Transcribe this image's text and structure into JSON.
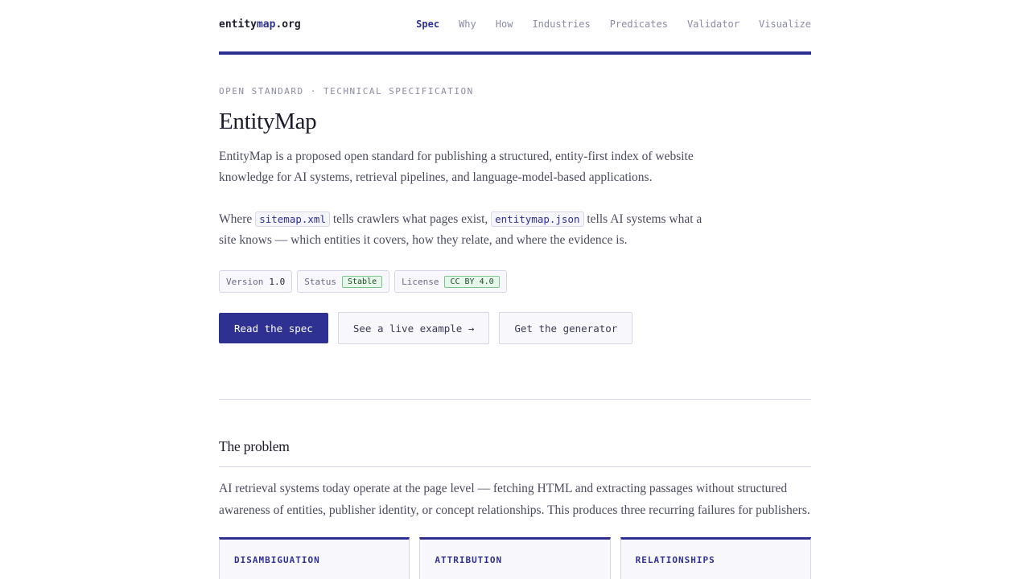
{
  "header": {
    "logo": {
      "part1": "entity",
      "part2": "map",
      "part3": ".org"
    },
    "nav": [
      {
        "label": "Spec",
        "active": true
      },
      {
        "label": "Why",
        "active": false
      },
      {
        "label": "How",
        "active": false
      },
      {
        "label": "Industries",
        "active": false
      },
      {
        "label": "Predicates",
        "active": false
      },
      {
        "label": "Validator",
        "active": false
      },
      {
        "label": "Visualize",
        "active": false
      }
    ]
  },
  "hero": {
    "eyebrow": "OPEN STANDARD · TECHNICAL SPECIFICATION",
    "title": "EntityMap",
    "lead": "EntityMap is a proposed open standard for publishing a structured, entity-first index of website knowledge for AI systems, retrieval pipelines, and language-model-based applications.",
    "compare": {
      "where": "Where",
      "code1": "sitemap.xml",
      "mid": "tells crawlers what pages exist,",
      "code2": "entitymap.json",
      "end": "tells AI systems what a site knows — which entities it covers, how they relate, and where the evidence is."
    },
    "badges": {
      "version_label": "Version",
      "version_value": "1.0",
      "status_label": "Status",
      "status_value": "Stable",
      "license_label": "License",
      "license_value": "CC BY 4.0"
    },
    "buttons": {
      "read_spec": "Read the spec",
      "live_example": "See a live example →",
      "generator": "Get the generator"
    }
  },
  "problem": {
    "heading": "The problem",
    "body": "AI retrieval systems today operate at the page level — fetching HTML and extracting passages without structured awareness of entities, publisher identity, or concept relationships. This produces three recurring failures for publishers.",
    "cards": [
      "DISAMBIGUATION",
      "ATTRIBUTION",
      "RELATIONSHIPS"
    ]
  },
  "colors": {
    "accent": "#2e3192",
    "muted": "#8a8aa6",
    "border": "#d6d6e6",
    "status_green": "#e7f6ea"
  }
}
